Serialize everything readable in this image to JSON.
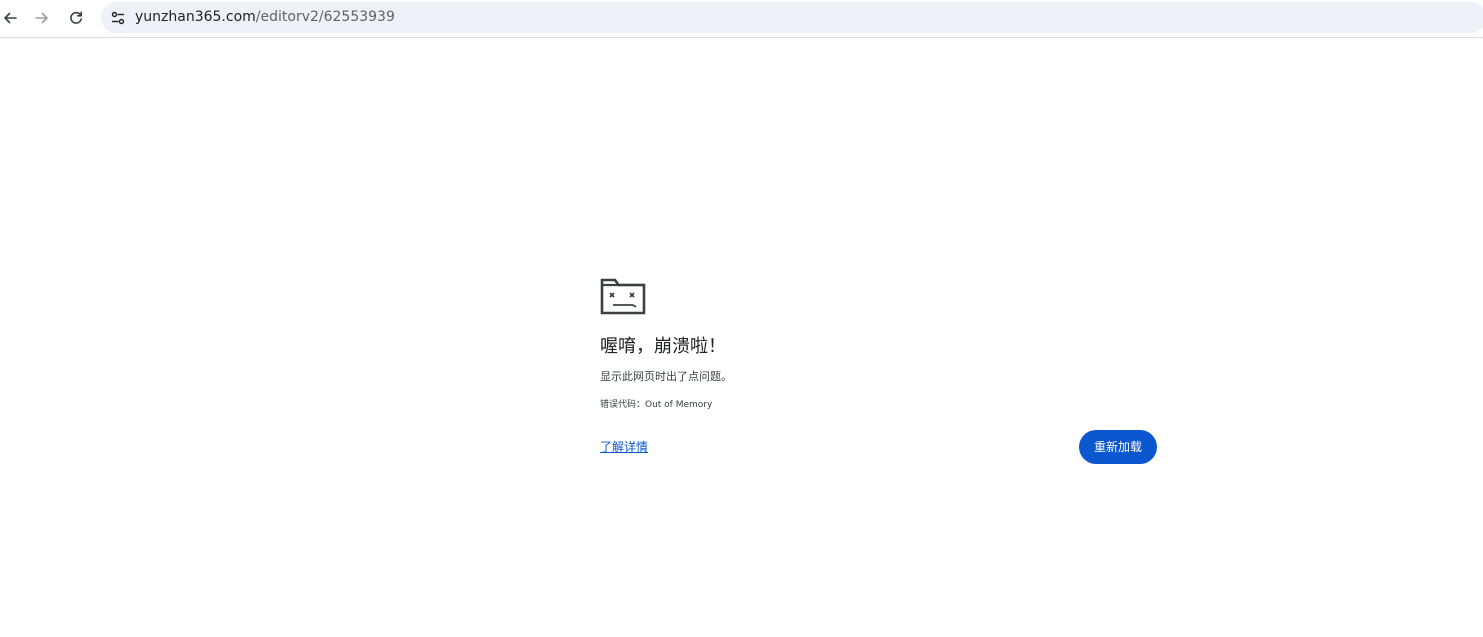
{
  "browser": {
    "url_host": "yunzhan365.com",
    "url_path": "/editorv2/62553939",
    "icons": {
      "back": "arrow-left-icon",
      "forward": "arrow-right-icon",
      "reload": "reload-icon",
      "site_info": "tune-icon"
    }
  },
  "error_page": {
    "icon": "sad-tab-icon",
    "title": "喔唷，崩溃啦！",
    "description": "显示此网页时出了点问题。",
    "error_code": "错误代码：Out of Memory",
    "learn_more_label": "了解详情",
    "reload_label": "重新加载",
    "colors": {
      "link": "#0b57d0",
      "button_bg": "#0b57d0",
      "button_text": "#ffffff"
    }
  }
}
